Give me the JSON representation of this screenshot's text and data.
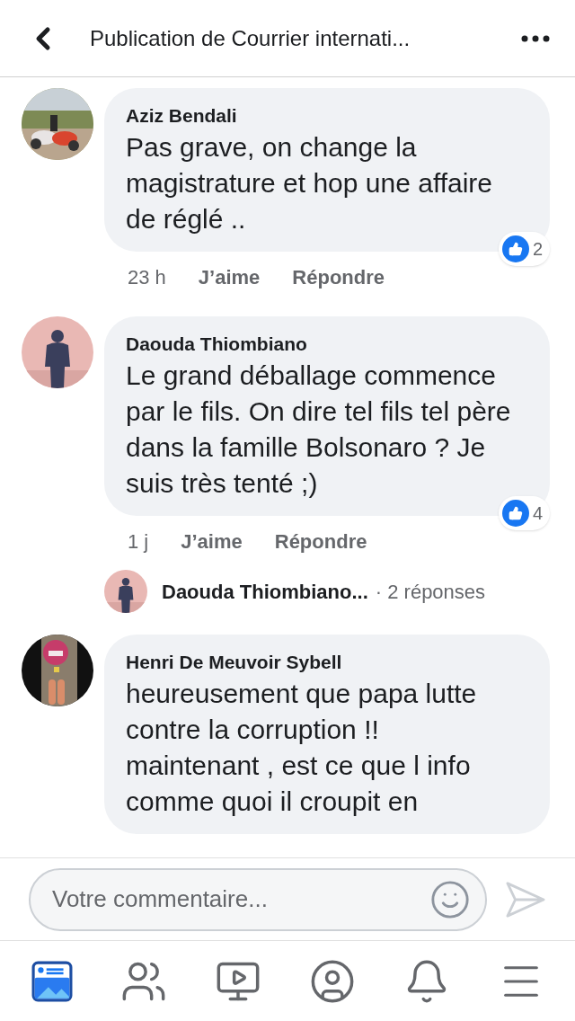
{
  "header": {
    "title": "Publication de Courrier internati..."
  },
  "comments": [
    {
      "author": "Aziz Bendali",
      "text": "Pas grave, on change la magistrature et hop une affaire de réglé ..",
      "time": "23 h",
      "like_label": "J’aime",
      "reply_label": "Répondre",
      "reactions": "2"
    },
    {
      "author": "Daouda Thiombiano",
      "text": "Le grand déballage commence par le fils. On dire tel fils tel père dans la famille Bolsonaro ? Je suis très tenté ;)",
      "time": "1 j",
      "like_label": "J’aime",
      "reply_label": "Répondre",
      "reactions": "4",
      "replies_preview": {
        "author": "Daouda Thiombiano...",
        "count": "· 2 réponses"
      }
    },
    {
      "author": "Henri De Meuvoir Sybell",
      "text": "heureusement que papa lutte contre la corruption !! maintenant , est ce que l info comme quoi il croupit en"
    }
  ],
  "composer": {
    "placeholder": "Votre commentaire..."
  },
  "tabs": [
    {
      "kind": "feed",
      "selected": true
    },
    {
      "kind": "friends",
      "selected": false
    },
    {
      "kind": "video",
      "selected": false
    },
    {
      "kind": "profile",
      "selected": false
    },
    {
      "kind": "notifications",
      "selected": false
    },
    {
      "kind": "menu",
      "selected": false
    }
  ]
}
